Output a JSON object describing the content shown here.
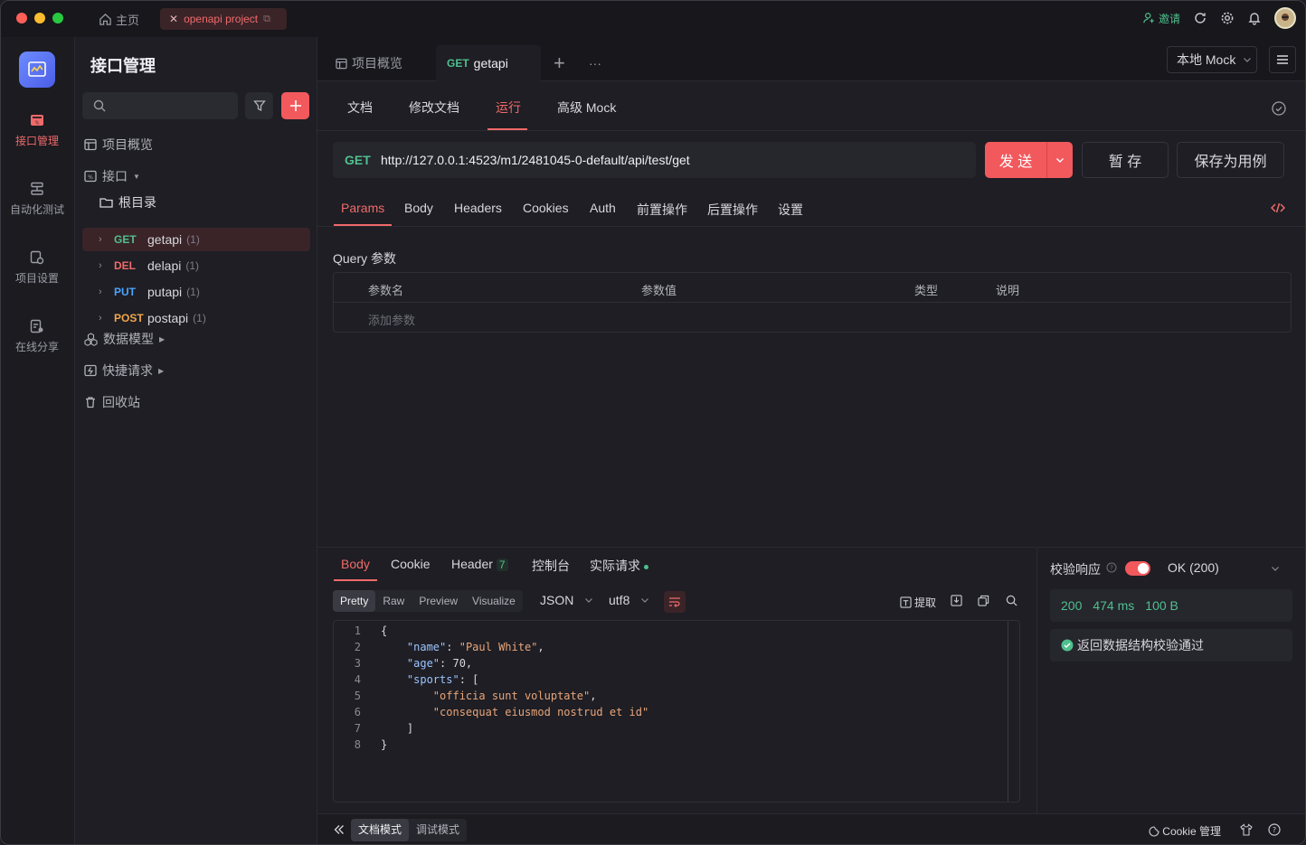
{
  "titlebar": {
    "home_label": "主页",
    "project_tab": "openapi project",
    "invite": "邀请"
  },
  "rail": {
    "items": [
      {
        "label": "接口管理"
      },
      {
        "label": "自动化测试"
      },
      {
        "label": "项目设置"
      },
      {
        "label": "在线分享"
      }
    ]
  },
  "sidebar": {
    "title": "接口管理",
    "search_placeholder": "",
    "overview": "项目概览",
    "api_group": "接口",
    "root": "根目录",
    "apis": [
      {
        "method": "GET",
        "name": "getapi",
        "count": "(1)",
        "color": "#4fc08d"
      },
      {
        "method": "DEL",
        "name": "delapi",
        "count": "(1)",
        "color": "#f06a6a"
      },
      {
        "method": "PUT",
        "name": "putapi",
        "count": "(1)",
        "color": "#4aa3ff"
      },
      {
        "method": "POST",
        "name": "postapi",
        "count": "(1)",
        "color": "#f2a64a"
      }
    ],
    "data_model": "数据模型",
    "quick_request": "快捷请求",
    "recycle": "回收站"
  },
  "tabs": {
    "overview": "项目概览",
    "get_method": "GET",
    "get_name": "getapi",
    "plus": "+",
    "more": "···",
    "mock": "本地 Mock"
  },
  "subtabs": [
    "文档",
    "修改文档",
    "运行",
    "高级 Mock"
  ],
  "request": {
    "method": "GET",
    "url": "http://127.0.0.1:4523/m1/2481045-0-default/api/test/get",
    "send": "发 送",
    "save": "暂 存",
    "save_case": "保存为用例"
  },
  "param_tabs": [
    "Params",
    "Body",
    "Headers",
    "Cookies",
    "Auth",
    "前置操作",
    "后置操作",
    "设置"
  ],
  "query": {
    "label": "Query 参数",
    "headers": [
      "参数名",
      "参数值",
      "类型",
      "说明"
    ],
    "add_placeholder": "添加参数"
  },
  "response": {
    "tabs": [
      "Body",
      "Cookie",
      "Header",
      "控制台",
      "实际请求"
    ],
    "header_count": "7",
    "formats": [
      "Pretty",
      "Raw",
      "Preview",
      "Visualize"
    ],
    "type": "JSON",
    "encoding": "utf8",
    "extract": "提取",
    "code_lines": [
      "{",
      "    \"name\": \"Paul White\",",
      "    \"age\": 70,",
      "    \"sports\": [",
      "        \"officia sunt voluptate\",",
      "        \"consequat eiusmod nostrud et id\"",
      "    ]",
      "}"
    ],
    "line_numbers": [
      "1",
      "2",
      "3",
      "4",
      "5",
      "6",
      "7",
      "8"
    ]
  },
  "validation": {
    "label": "校验响应",
    "status_text": "OK (200)",
    "code": "200",
    "time": "474 ms",
    "size": "100 B",
    "result": "返回数据结构校验通过"
  },
  "footer": {
    "doc_mode": "文档模式",
    "debug_mode": "调试模式",
    "cookie": "Cookie 管理"
  },
  "colors": {
    "accent": "#f2595d",
    "success": "#4fc08d"
  }
}
